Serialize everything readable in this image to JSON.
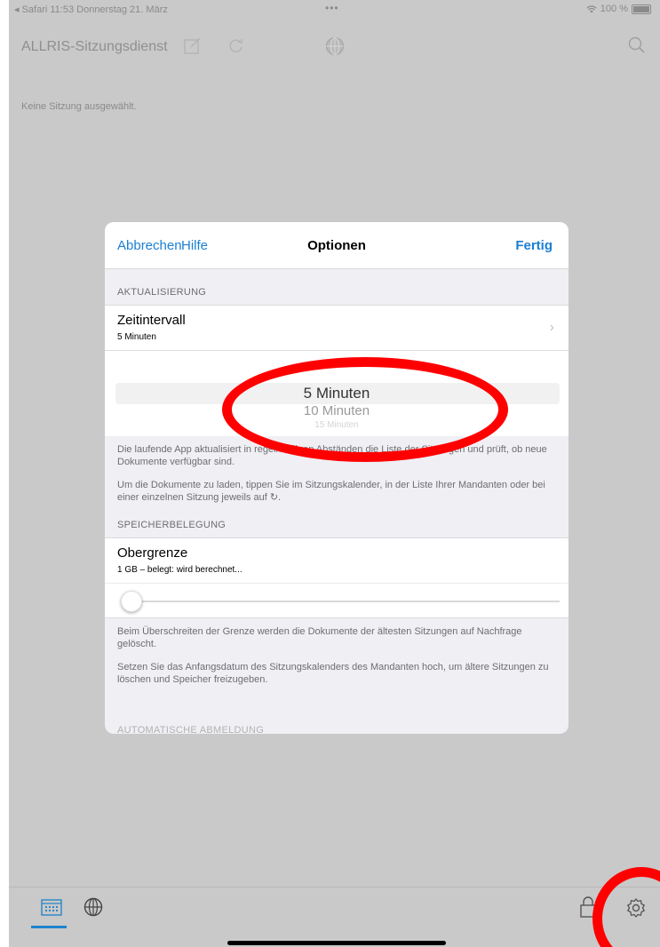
{
  "status_bar": {
    "left": "◂ Safari  11:53  Donnerstag 21. März",
    "center": "•••",
    "right": "100 %"
  },
  "app": {
    "title": "ALLRIS-Sitzungsdienst",
    "empty_message": "Keine Sitzung ausgewählt."
  },
  "modal": {
    "cancel_label": "Abbrechen",
    "help_label": "Hilfe",
    "title": "Optionen",
    "done_label": "Fertig",
    "update": {
      "section_header": "AKTUALISIERUNG",
      "interval_title": "Zeitintervall",
      "interval_value": "5 Minuten",
      "picker_selected": "5 Minuten",
      "picker_next": "10 Minuten",
      "picker_next2": "15 Minuten",
      "footer_1": "Die laufende App aktualisiert in regelmäßigen Abständen die Liste der Sitzungen und prüft, ob neue Dokumente verfügbar sind.",
      "footer_2": "Um die Dokumente zu laden, tippen Sie im Sitzungskalender, in der Liste Ihrer Mandanten oder bei einer einzelnen Sitzung jeweils auf ↻."
    },
    "storage": {
      "section_header": "SPEICHERBELEGUNG",
      "limit_title": "Obergrenze",
      "limit_value": "1 GB – belegt: wird berechnet...",
      "slider_fraction": 0.0,
      "footer_1": "Beim Überschreiten der Grenze werden die Dokumente der ältesten Sitzungen auf Nachfrage gelöscht.",
      "footer_2": "Setzen Sie das Anfangsdatum des Sitzungskalenders des Mandanten hoch, um ältere Sitzungen zu löschen und Speicher freizugeben."
    },
    "next_section_header": "AUTOMATISCHE ABMELDUNG"
  },
  "icons": {
    "status_wifi": "wifi-icon",
    "battery": "battery-icon",
    "compose": "compose-icon",
    "refresh": "refresh-icon",
    "globe": "globe-icon",
    "search": "search-icon",
    "calendar": "calendar-icon",
    "lock": "lock-icon",
    "settings": "gear-icon"
  },
  "colors": {
    "accent": "#1a7fd4",
    "annotation": "#ff0000"
  }
}
